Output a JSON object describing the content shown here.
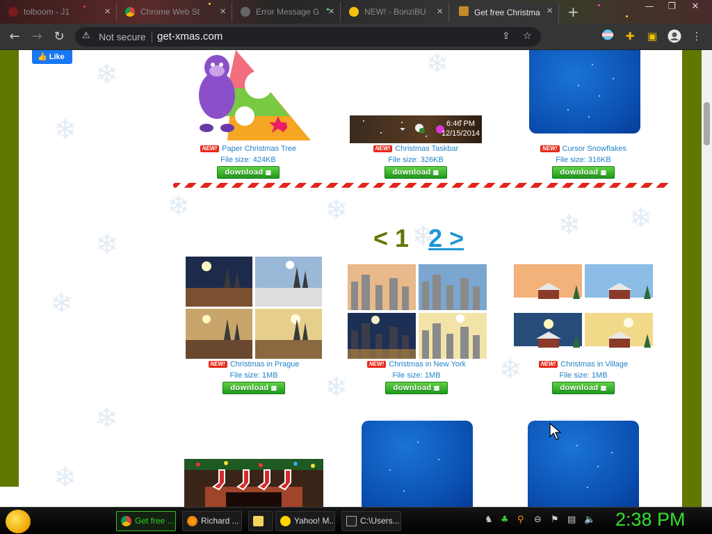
{
  "browser": {
    "tabs": [
      {
        "label": "tolboom - J1",
        "active": false
      },
      {
        "label": "Chrome Web St",
        "active": false
      },
      {
        "label": "Error Message G",
        "active": false
      },
      {
        "label": "NEW! - BonziBU",
        "active": false
      },
      {
        "label": "Get free Christma",
        "active": true
      }
    ],
    "new_tab": "+",
    "window_controls": {
      "minimize": "—",
      "restore": "❐",
      "close": "✕"
    },
    "nav": {
      "back": "←",
      "forward": "→",
      "reload": "↻"
    },
    "security": "Not secure",
    "url": "get-xmas.com",
    "accent": "#1a73e8"
  },
  "page": {
    "fb_like": "Like",
    "pagination": {
      "prev": "<",
      "current": "1",
      "next": "2 >"
    },
    "items_top": [
      {
        "badge": "NEW!",
        "name": "Paper Christmas Tree",
        "size": "File size: 424KB",
        "button": "download"
      },
      {
        "badge": "NEW!",
        "name": "Christmas Taskbar",
        "size": "File size: 326KB",
        "button": "download",
        "preview_time": "6:46 PM",
        "preview_date": "12/15/2014"
      },
      {
        "badge": "NEW!",
        "name": "Cursor Snowflakes",
        "size": "File size: 316KB",
        "button": "download"
      }
    ],
    "items_mid": [
      {
        "badge": "NEW!",
        "name": "Christmas in Prague",
        "size": "File size: 1MB",
        "button": "download"
      },
      {
        "badge": "NEW!",
        "name": "Christmas in New York",
        "size": "File size: 1MB",
        "button": "download"
      },
      {
        "badge": "NEW!",
        "name": "Christmas in Village",
        "size": "File size: 1MB",
        "button": "download"
      }
    ]
  },
  "taskbar": {
    "buttons": [
      {
        "label": "Get free ...",
        "active": true
      },
      {
        "label": "Richard ...",
        "active": false
      },
      {
        "label": "",
        "active": false
      },
      {
        "label": "Yahoo! M...",
        "active": false
      },
      {
        "label": "C:\\Users...",
        "active": false
      }
    ],
    "clock": "2:38 PM"
  },
  "colors": {
    "page_bg": "#5f7800",
    "link": "#1f82c6",
    "download_green": "#2aa823",
    "clock": "#33e12a"
  }
}
